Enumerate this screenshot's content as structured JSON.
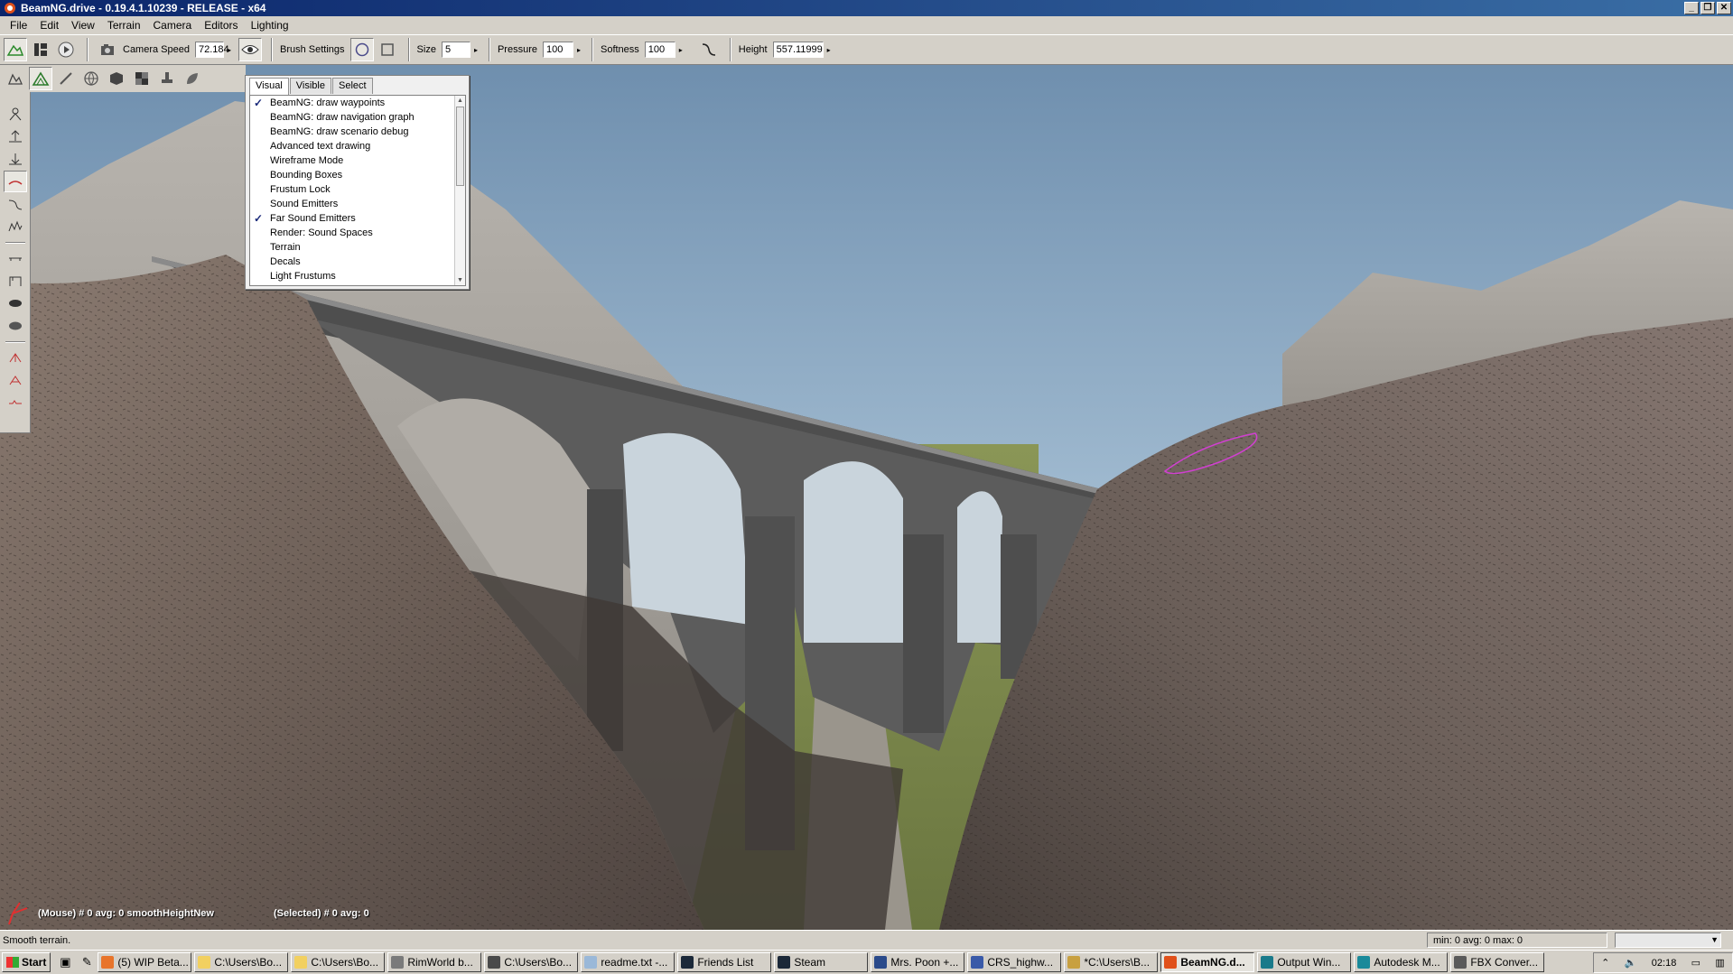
{
  "window": {
    "title": "BeamNG.drive - 0.19.4.1.10239 - RELEASE - x64",
    "minimize": "_",
    "restore": "❐",
    "close": "✕"
  },
  "menu": [
    "File",
    "Edit",
    "View",
    "Terrain",
    "Camera",
    "Editors",
    "Lighting"
  ],
  "toolbar": {
    "camera_speed_label": "Camera Speed",
    "camera_speed_value": "72.184",
    "brush_settings_label": "Brush Settings",
    "size_label": "Size",
    "size_value": "5",
    "pressure_label": "Pressure",
    "pressure_value": "100",
    "softness_label": "Softness",
    "softness_value": "100",
    "height_label": "Height",
    "height_value": "557.11999",
    "spin_glyph": "▸"
  },
  "visibility_panel": {
    "tabs": [
      "Visual",
      "Visible",
      "Select"
    ],
    "items": [
      {
        "label": "BeamNG: draw waypoints",
        "checked": "✓"
      },
      {
        "label": "BeamNG: draw navigation graph",
        "checked": ""
      },
      {
        "label": "BeamNG: draw scenario debug",
        "checked": ""
      },
      {
        "label": "Advanced text drawing",
        "checked": ""
      },
      {
        "label": "Wireframe Mode",
        "checked": ""
      },
      {
        "label": "Bounding Boxes",
        "checked": ""
      },
      {
        "label": "Frustum Lock",
        "checked": ""
      },
      {
        "label": "Sound Emitters",
        "checked": ""
      },
      {
        "label": "Far Sound Emitters",
        "checked": "✓"
      },
      {
        "label": "Render: Sound Spaces",
        "checked": ""
      },
      {
        "label": "Terrain",
        "checked": ""
      },
      {
        "label": "Decals",
        "checked": ""
      },
      {
        "label": "Light Frustums",
        "checked": ""
      }
    ]
  },
  "viewport": {
    "mouse_info": "(Mouse) # 0  avg: 0 smoothHeightNew",
    "selected_info": "(Selected) # 0  avg: 0"
  },
  "statusbar": {
    "message": "Smooth terrain.",
    "stats": "min: 0  avg: 0  max: 0"
  },
  "taskbar": {
    "start_label": "Start",
    "items": [
      {
        "label": "(5) WIP Beta...",
        "color": "#e8742a"
      },
      {
        "label": "C:\\Users\\Bo...",
        "color": "#f2d060"
      },
      {
        "label": "C:\\Users\\Bo...",
        "color": "#f2d060"
      },
      {
        "label": "RimWorld b...",
        "color": "#7a7a7a"
      },
      {
        "label": "C:\\Users\\Bo...",
        "color": "#4a4a4a"
      },
      {
        "label": "readme.txt -...",
        "color": "#9ab8d8"
      },
      {
        "label": "Friends List",
        "color": "#1b2838"
      },
      {
        "label": "Steam",
        "color": "#1b2838"
      },
      {
        "label": "Mrs. Poon +...",
        "color": "#2a4a8a"
      },
      {
        "label": "CRS_highw...",
        "color": "#3a5aa8"
      },
      {
        "label": "*C:\\Users\\B...",
        "color": "#c8a040"
      },
      {
        "label": "BeamNG.d...",
        "color": "#e0501a"
      },
      {
        "label": "Output Win...",
        "color": "#1a7a8a"
      },
      {
        "label": "Autodesk M...",
        "color": "#1a8a9a"
      },
      {
        "label": "FBX Conver...",
        "color": "#5a5a5a"
      }
    ],
    "clock": "02:18"
  }
}
